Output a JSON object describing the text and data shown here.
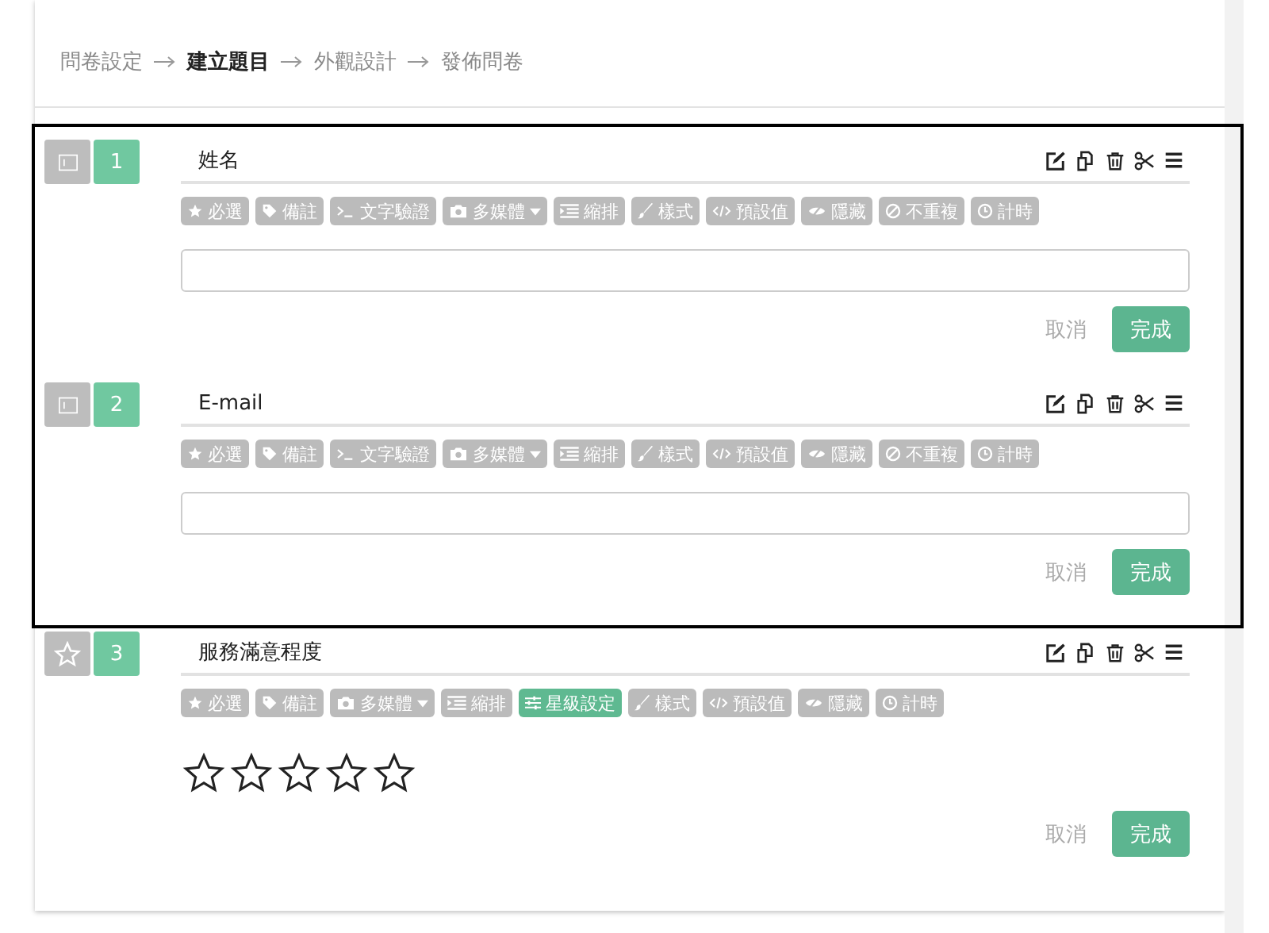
{
  "breadcrumb": [
    {
      "label": "問卷設定",
      "selected": false
    },
    {
      "label": "建立題目",
      "selected": true
    },
    {
      "label": "外觀設計",
      "selected": false
    },
    {
      "label": "發佈問卷",
      "selected": false
    }
  ],
  "groups": [
    {
      "highlighted": true,
      "questions": [
        {
          "kind": "text",
          "number": "1",
          "title": "姓名",
          "tools": [
            {
              "kind": "star",
              "label": "必選",
              "selected": false
            },
            {
              "kind": "tag",
              "label": "備註",
              "selected": false
            },
            {
              "kind": "terminal",
              "label": "文字驗證",
              "selected": false
            },
            {
              "kind": "camera",
              "label": "多媒體",
              "selected": false,
              "has_menu": true
            },
            {
              "kind": "indent",
              "label": "縮排",
              "selected": false
            },
            {
              "kind": "brush",
              "label": "樣式",
              "selected": false
            },
            {
              "kind": "code",
              "label": "預設值",
              "selected": false
            },
            {
              "kind": "eye-slash",
              "label": "隱藏",
              "selected": false
            },
            {
              "kind": "ban",
              "label": "不重複",
              "selected": false
            },
            {
              "kind": "clock",
              "label": "計時",
              "selected": false
            }
          ],
          "cancel": "取消",
          "done": "完成"
        },
        {
          "kind": "text",
          "number": "2",
          "title": "E-mail",
          "tools": [
            {
              "kind": "star",
              "label": "必選",
              "selected": false
            },
            {
              "kind": "tag",
              "label": "備註",
              "selected": false
            },
            {
              "kind": "terminal",
              "label": "文字驗證",
              "selected": false
            },
            {
              "kind": "camera",
              "label": "多媒體",
              "selected": false,
              "has_menu": true
            },
            {
              "kind": "indent",
              "label": "縮排",
              "selected": false
            },
            {
              "kind": "brush",
              "label": "樣式",
              "selected": false
            },
            {
              "kind": "code",
              "label": "預設值",
              "selected": false
            },
            {
              "kind": "eye-slash",
              "label": "隱藏",
              "selected": false
            },
            {
              "kind": "ban",
              "label": "不重複",
              "selected": false
            },
            {
              "kind": "clock",
              "label": "計時",
              "selected": false
            }
          ],
          "cancel": "取消",
          "done": "完成"
        }
      ]
    },
    {
      "highlighted": false,
      "questions": [
        {
          "kind": "rating",
          "number": "3",
          "title": "服務滿意程度",
          "stars": 0,
          "tools": [
            {
              "kind": "star",
              "label": "必選",
              "selected": false
            },
            {
              "kind": "tag",
              "label": "備註",
              "selected": false
            },
            {
              "kind": "camera",
              "label": "多媒體",
              "selected": false,
              "has_menu": true
            },
            {
              "kind": "indent",
              "label": "縮排",
              "selected": false
            },
            {
              "kind": "sliders",
              "label": "星級設定",
              "selected": true
            },
            {
              "kind": "brush",
              "label": "樣式",
              "selected": false
            },
            {
              "kind": "code",
              "label": "預設值",
              "selected": false
            },
            {
              "kind": "eye-slash",
              "label": "隱藏",
              "selected": false
            },
            {
              "kind": "clock",
              "label": "計時",
              "selected": false
            }
          ],
          "cancel": "取消",
          "done": "完成"
        }
      ]
    }
  ]
}
